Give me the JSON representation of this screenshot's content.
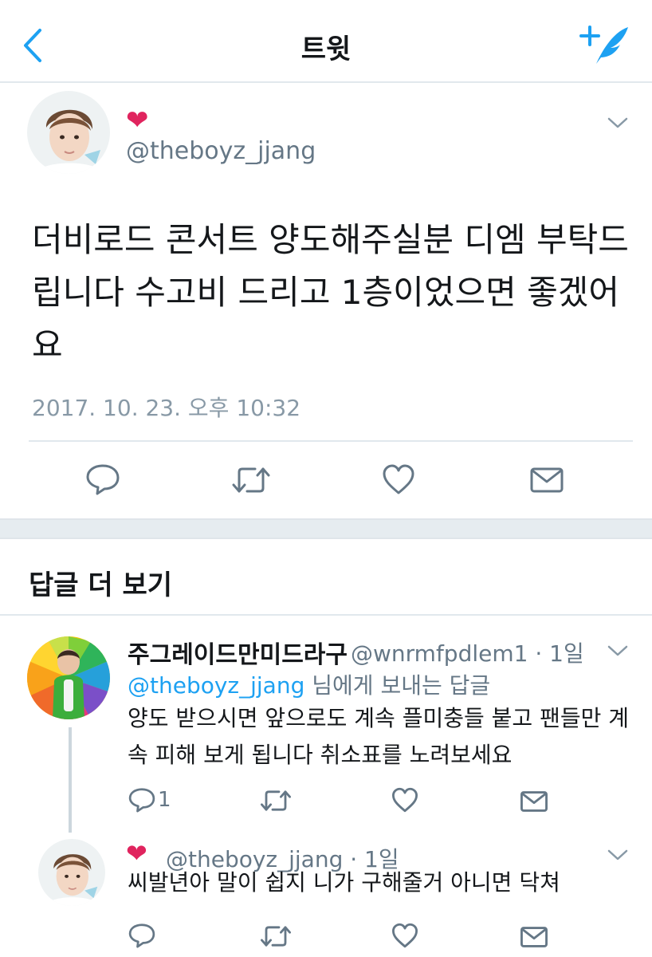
{
  "nav": {
    "title": "트윗"
  },
  "tweet": {
    "handle": "@theboyz_jjang",
    "text": "더비로드 콘서트 양도해주실분 디엠 부탁드립니다 수고비 드리고 1층이었으면 좋겠어요",
    "timestamp": "2017. 10. 23. 오후 10:32"
  },
  "replies_section": {
    "title": "답글 더 보기"
  },
  "reply1": {
    "name": "주그레이드만미드라구",
    "handle_time": "@wnrmfpdlem1 · 1일",
    "reply_to_mention": "@theboyz_jjang",
    "reply_to_suffix": " 님에게 보내는 답글",
    "text": "양도 받으시면 앞으로도 계속 플미충들 붙고 팬들만 계속 피해 보게 됩니다 취소표를 노려보세요",
    "reply_count": "1"
  },
  "reply2": {
    "handle_time": "@theboyz_jjang · 1일",
    "text": "씨발년아 말이 쉽지 니가 구해줄거 아니면 닥쳐"
  },
  "colors": {
    "accent": "#1da1f2",
    "heart": "#e0245e",
    "secondary_text": "#657786",
    "icon": "#657786"
  },
  "icons": [
    "back-arrow-icon",
    "compose-tweet-icon",
    "heart-emoji-icon",
    "chevron-down-icon",
    "reply-icon",
    "retweet-icon",
    "like-icon",
    "direct-message-icon"
  ]
}
